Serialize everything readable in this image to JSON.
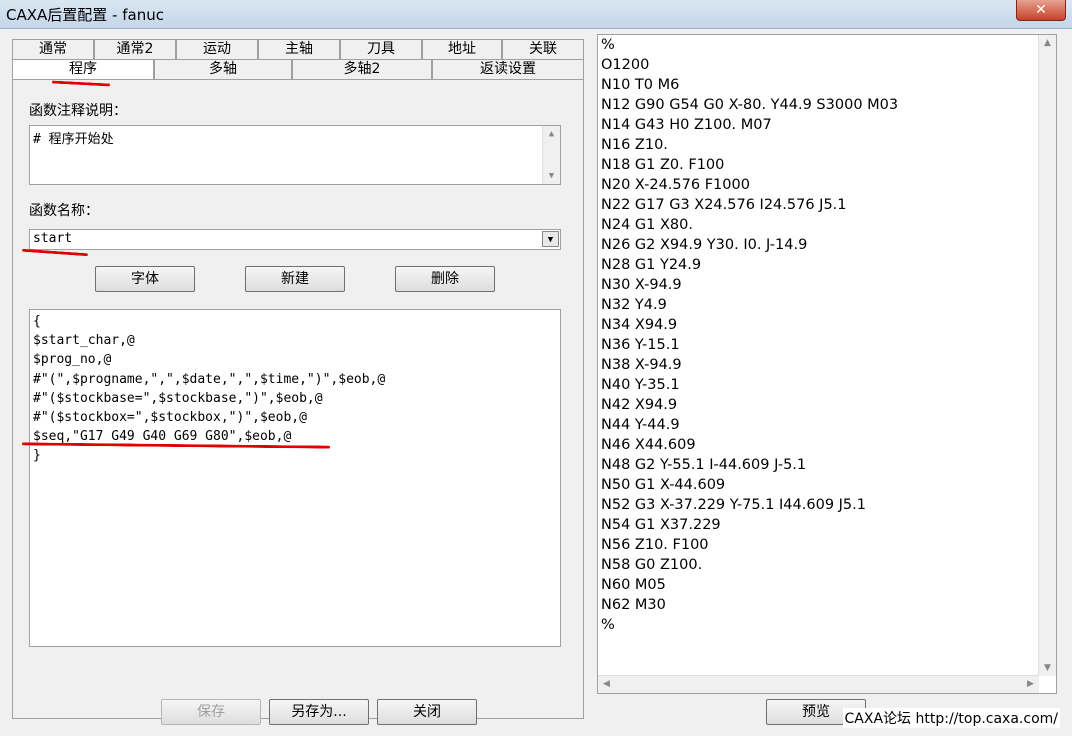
{
  "window": {
    "title": "CAXA后置配置 - fanuc",
    "close_glyph": "✕"
  },
  "tabs_row1": [
    "通常",
    "通常2",
    "运动",
    "主轴",
    "刀具",
    "地址",
    "关联"
  ],
  "tabs_row2": [
    "程序",
    "多轴",
    "多轴2",
    "返读设置"
  ],
  "active_tab": "程序",
  "panel": {
    "comment_label": "函数注释说明：",
    "comment_value": "# 程序开始处",
    "name_label": "函数名称：",
    "name_value": "start",
    "buttons": {
      "font": "字体",
      "new": "新建",
      "delete": "删除"
    },
    "code_lines": [
      "{",
      "$start_char,@",
      "$prog_no,@",
      "#\"(\",$progname,\",\",$date,\",\",$time,\")\",$eob,@",
      "#\"($stockbase=\",$stockbase,\")\",$eob,@",
      "#\"($stockbox=\",$stockbox,\")\",$eob,@",
      "$seq,\"G17 G49 G40 G69 G80\",$eob,@",
      "}"
    ]
  },
  "bottom_buttons": {
    "save": "保存",
    "save_as": "另存为...",
    "close": "关闭",
    "preview": "预览"
  },
  "output_lines": [
    "%",
    "O1200",
    "N10 T0 M6",
    "N12 G90 G54 G0 X-80. Y44.9 S3000 M03",
    "N14 G43 H0 Z100. M07",
    "N16 Z10.",
    "N18 G1 Z0. F100",
    "N20 X-24.576 F1000",
    "N22 G17 G3 X24.576 I24.576 J5.1",
    "N24 G1 X80.",
    "N26 G2 X94.9 Y30. I0. J-14.9",
    "N28 G1 Y24.9",
    "N30 X-94.9",
    "N32 Y4.9",
    "N34 X94.9",
    "N36 Y-15.1",
    "N38 X-94.9",
    "N40 Y-35.1",
    "N42 X94.9",
    "N44 Y-44.9",
    "N46 X44.609",
    "N48 G2 Y-55.1 I-44.609 J-5.1",
    "N50 G1 X-44.609",
    "N52 G3 X-37.229 Y-75.1 I44.609 J5.1",
    "N54 G1 X37.229",
    "N56 Z10. F100",
    "N58 G0 Z100.",
    "N60 M05",
    "N62 M30",
    "%"
  ],
  "watermark": "CAXA论坛 http://top.caxa.com/",
  "colors": {
    "annotation_red": "#e00000"
  }
}
